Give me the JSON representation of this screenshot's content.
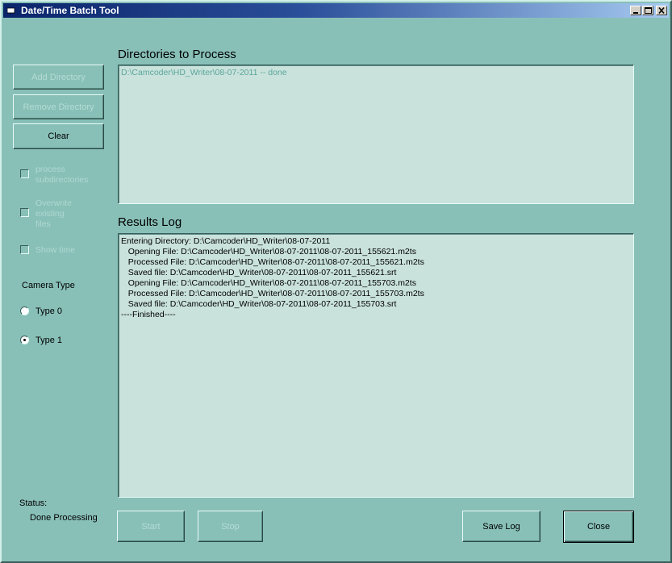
{
  "window": {
    "title": "Date/Time Batch Tool",
    "minimize_icon": "minimize-icon",
    "maximize_icon": "maximize-icon",
    "close_icon": "close-icon",
    "app_icon": "app-icon"
  },
  "sidebar": {
    "add_directory": "Add Directory",
    "remove_directory": "Remove Directory",
    "clear": "Clear",
    "process_subdirectories": [
      "process",
      "subdirectories"
    ],
    "overwrite_existing": [
      "Overwrite",
      "existing",
      "files"
    ],
    "show_time": "Show time",
    "camera_type_label": "Camera Type",
    "type0": "Type 0",
    "type1": "Type 1",
    "selected_type": "Type 1",
    "status_label": "Status:",
    "status_value": "Done Processing"
  },
  "directories": {
    "heading": "Directories to Process",
    "items": [
      "D:\\Camcoder\\HD_Writer\\08-07-2011 -- done"
    ]
  },
  "results": {
    "heading": "Results Log",
    "lines": [
      "Entering Directory: D:\\Camcoder\\HD_Writer\\08-07-2011",
      "   Opening File: D:\\Camcoder\\HD_Writer\\08-07-2011\\08-07-2011_155621.m2ts",
      "   Processed File: D:\\Camcoder\\HD_Writer\\08-07-2011\\08-07-2011_155621.m2ts",
      "   Saved file: D:\\Camcoder\\HD_Writer\\08-07-2011\\08-07-2011_155621.srt",
      "   Opening File: D:\\Camcoder\\HD_Writer\\08-07-2011\\08-07-2011_155703.m2ts",
      "   Processed File: D:\\Camcoder\\HD_Writer\\08-07-2011\\08-07-2011_155703.m2ts",
      "   Saved file: D:\\Camcoder\\HD_Writer\\08-07-2011\\08-07-2011_155703.srt",
      "----Finished----"
    ]
  },
  "footer": {
    "start": "Start",
    "stop": "Stop",
    "save_log": "Save Log",
    "close": "Close"
  },
  "colors": {
    "background": "#88c0b8",
    "panel": "#c9e2db",
    "disabled_text": "#b4dcd4",
    "title_gradient_start": "#0a246a",
    "title_gradient_end": "#a6caf0"
  }
}
